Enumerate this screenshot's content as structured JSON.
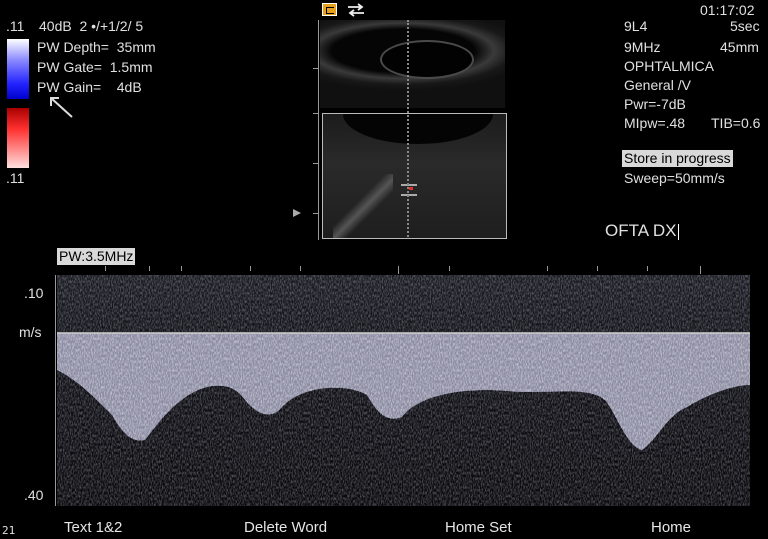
{
  "color_scale": {
    "top_value": ".11",
    "bottom_value": ".11",
    "colors": {
      "positive_top": "#ffffff",
      "positive": "#2222ff",
      "negative": "#ff3030"
    }
  },
  "settings": {
    "gain_mode": "40dB  2 •/+1/2/ 5",
    "pw_depth": "PW Depth=  35mm",
    "pw_gate": "PW Gate=  1.5mm",
    "pw_gain": "PW Gain=    4dB"
  },
  "header": {
    "clock": "01:17:02"
  },
  "probe": {
    "model": "9L4",
    "time": "5sec",
    "freq": "9MHz",
    "depth": "45mm",
    "app": "OPHTALMICA",
    "preset": "General /V",
    "power": "Pwr=-7dB",
    "mi": "MIpw=.48",
    "tib": "TIB=0.6"
  },
  "status": {
    "store": "Store in progress",
    "sweep": "Sweep=50mm/s"
  },
  "annotation": {
    "text": "OFTA DX"
  },
  "spectral": {
    "label": "PW:3.5MHz",
    "scale_top": ".10",
    "unit": "m/s",
    "scale_bottom": ".40",
    "colors": {
      "trace": "#c8c8dc",
      "baseline": "#d0d0d0"
    }
  },
  "footer": {
    "page_number": "21",
    "softkeys": [
      "Text 1&2",
      "Delete Word",
      "Home Set",
      "Home"
    ]
  }
}
